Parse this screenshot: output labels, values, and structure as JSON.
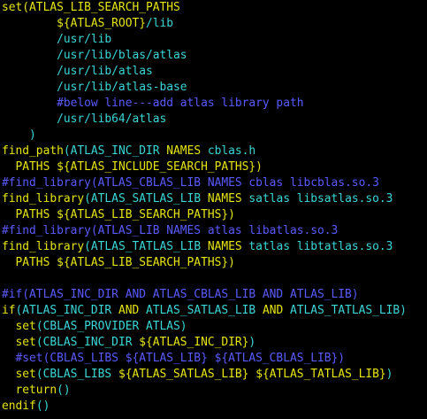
{
  "colors": {
    "background": "#000000",
    "command": "#e5e510",
    "argument": "#3bd6d6",
    "comment": "#5a5aff"
  },
  "lines": [
    [
      {
        "t": "set(ATLAS_LIB_SEARCH_PATHS",
        "c": "yellow"
      }
    ],
    [
      {
        "t": "        ",
        "c": "cyan"
      },
      {
        "t": "${ATLAS_ROOT}",
        "c": "yellow"
      },
      {
        "t": "/lib",
        "c": "cyan"
      }
    ],
    [
      {
        "t": "        /usr/lib",
        "c": "cyan"
      }
    ],
    [
      {
        "t": "        /usr/lib/blas/atlas",
        "c": "cyan"
      }
    ],
    [
      {
        "t": "        /usr/lib/atlas",
        "c": "cyan"
      }
    ],
    [
      {
        "t": "        /usr/lib/atlas-base",
        "c": "cyan"
      }
    ],
    [
      {
        "t": "        #below line---add atlas library path",
        "c": "blue"
      }
    ],
    [
      {
        "t": "        /usr/lib64/atlas",
        "c": "cyan"
      }
    ],
    [
      {
        "t": "    )",
        "c": "cyan"
      }
    ],
    [
      {
        "t": "find_path",
        "c": "yellow"
      },
      {
        "t": "(ATLAS_INC_DIR ",
        "c": "cyan"
      },
      {
        "t": "NAMES",
        "c": "yellow"
      },
      {
        "t": " cblas.h",
        "c": "cyan"
      }
    ],
    [
      {
        "t": "  PATHS ",
        "c": "yellow"
      },
      {
        "t": "${ATLAS_INCLUDE_SEARCH_PATHS})",
        "c": "yellow"
      }
    ],
    [
      {
        "t": "#find_library(ATLAS_CBLAS_LIB NAMES cblas libcblas.so.3",
        "c": "blue"
      }
    ],
    [
      {
        "t": "find_library",
        "c": "yellow"
      },
      {
        "t": "(ATLAS_SATLAS_LIB ",
        "c": "cyan"
      },
      {
        "t": "NAMES",
        "c": "yellow"
      },
      {
        "t": " satlas libsatlas.so.3",
        "c": "cyan"
      }
    ],
    [
      {
        "t": "  PATHS ",
        "c": "yellow"
      },
      {
        "t": "${ATLAS_LIB_SEARCH_PATHS})",
        "c": "yellow"
      }
    ],
    [
      {
        "t": "#find_library(ATLAS_LIB NAMES atlas libatlas.so.3",
        "c": "blue"
      }
    ],
    [
      {
        "t": "find_library",
        "c": "yellow"
      },
      {
        "t": "(ATLAS_TATLAS_LIB ",
        "c": "cyan"
      },
      {
        "t": "NAMES",
        "c": "yellow"
      },
      {
        "t": " tatlas libtatlas.so.3",
        "c": "cyan"
      }
    ],
    [
      {
        "t": "  PATHS ",
        "c": "yellow"
      },
      {
        "t": "${ATLAS_LIB_SEARCH_PATHS})",
        "c": "yellow"
      }
    ],
    [
      {
        "t": "",
        "c": "cyan"
      }
    ],
    [
      {
        "t": "#if(ATLAS_INC_DIR AND ATLAS_CBLAS_LIB AND ATLAS_LIB)",
        "c": "blue"
      }
    ],
    [
      {
        "t": "if",
        "c": "yellow"
      },
      {
        "t": "(ATLAS_INC_DIR ",
        "c": "cyan"
      },
      {
        "t": "AND",
        "c": "yellow"
      },
      {
        "t": " ATLAS_SATLAS_LIB ",
        "c": "cyan"
      },
      {
        "t": "AND",
        "c": "yellow"
      },
      {
        "t": " ATLAS_TATLAS_LIB)",
        "c": "cyan"
      }
    ],
    [
      {
        "t": "  set",
        "c": "yellow"
      },
      {
        "t": "(CBLAS_PROVIDER ATLAS)",
        "c": "cyan"
      }
    ],
    [
      {
        "t": "  set",
        "c": "yellow"
      },
      {
        "t": "(CBLAS_INC_DIR ",
        "c": "cyan"
      },
      {
        "t": "${ATLAS_INC_DIR}",
        "c": "yellow"
      },
      {
        "t": ")",
        "c": "cyan"
      }
    ],
    [
      {
        "t": "  #set(CBLAS_LIBS ${ATLAS_LIB} ${ATLAS_CBLAS_LIB})",
        "c": "blue"
      }
    ],
    [
      {
        "t": "  set",
        "c": "yellow"
      },
      {
        "t": "(CBLAS_LIBS ",
        "c": "cyan"
      },
      {
        "t": "${ATLAS_SATLAS_LIB}",
        "c": "yellow"
      },
      {
        "t": " ",
        "c": "cyan"
      },
      {
        "t": "${ATLAS_TATLAS_LIB}",
        "c": "yellow"
      },
      {
        "t": ")",
        "c": "cyan"
      }
    ],
    [
      {
        "t": "  return",
        "c": "yellow"
      },
      {
        "t": "()",
        "c": "cyan"
      }
    ],
    [
      {
        "t": "endif",
        "c": "yellow"
      },
      {
        "t": "()",
        "c": "cyan"
      }
    ]
  ]
}
